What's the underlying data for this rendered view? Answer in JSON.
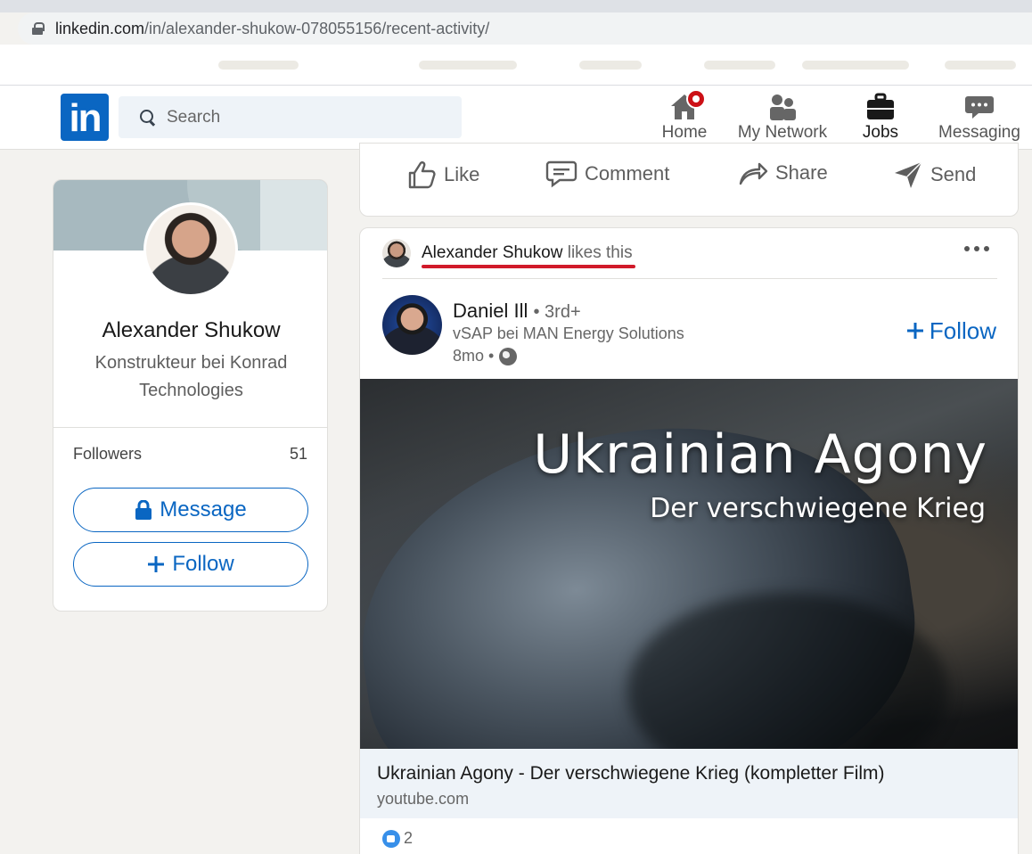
{
  "browser": {
    "url_host": "linkedin.com",
    "url_path": "/in/alexander-shukow-078055156/recent-activity/"
  },
  "nav": {
    "logo": "in",
    "search_placeholder": "Search",
    "items": [
      {
        "label": "Home",
        "icon": "home-icon"
      },
      {
        "label": "My Network",
        "icon": "network-icon"
      },
      {
        "label": "Jobs",
        "icon": "briefcase-icon"
      },
      {
        "label": "Messaging",
        "icon": "chat-icon"
      }
    ]
  },
  "profile": {
    "name": "Alexander Shukow",
    "headline": "Konstrukteur bei Konrad Technologies",
    "followers_label": "Followers",
    "followers_count": "51",
    "message_label": "Message",
    "follow_label": "Follow"
  },
  "actions": {
    "like": "Like",
    "comment": "Comment",
    "share": "Share",
    "send": "Send"
  },
  "post": {
    "liker_name": "Alexander Shukow",
    "liker_suffix": "likes this",
    "author_name": "Daniel Ill",
    "author_degree": "• 3rd+",
    "author_headline": "vSAP bei MAN Energy Solutions",
    "time": "8mo •",
    "follow_label": "Follow",
    "media_title": "Ukrainian Agony",
    "media_subtitle": "Der verschwiegene Krieg",
    "link_title": "Ukrainian Agony - Der verschwiegene Krieg (kompletter Film)",
    "link_domain": "youtube.com",
    "reaction_count": "2"
  },
  "colors": {
    "brand": "#0a66c2",
    "badge": "#cc1016",
    "annotation_underline": "#d11a2a"
  }
}
